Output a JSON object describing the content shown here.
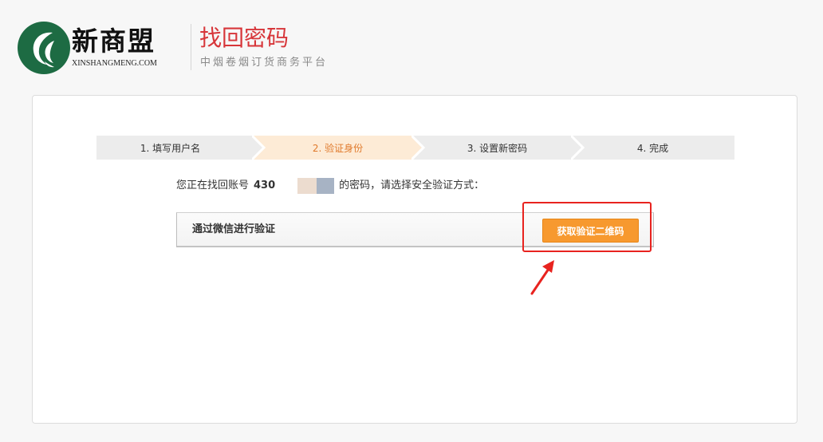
{
  "header": {
    "brand_name": "新商盟",
    "brand_domain": "XINSHANGMENG.COM",
    "page_title": "找回密码",
    "page_subtitle": "中烟卷烟订货商务平台"
  },
  "steps": [
    {
      "label": "1. 填写用户名",
      "active": false
    },
    {
      "label": "2. 验证身份",
      "active": true
    },
    {
      "label": "3. 设置新密码",
      "active": false
    },
    {
      "label": "4. 完成",
      "active": false
    }
  ],
  "info": {
    "prefix": "您正在找回账号",
    "account_visible": "430",
    "suffix": "的密码，请选择安全验证方式："
  },
  "verify": {
    "method_label": "通过微信进行验证",
    "button_label": "获取验证二维码"
  },
  "colors": {
    "title_red": "#d7363a",
    "active_step_bg": "#fdebd6",
    "inactive_step_bg": "#ececec",
    "button_orange": "#f7992f",
    "annotation_red": "#e8231f",
    "logo_green": "#1d6b43"
  },
  "icons": {
    "logo": "tobacco-leaf-logo-icon",
    "annotation_arrow": "red-arrow-icon"
  }
}
